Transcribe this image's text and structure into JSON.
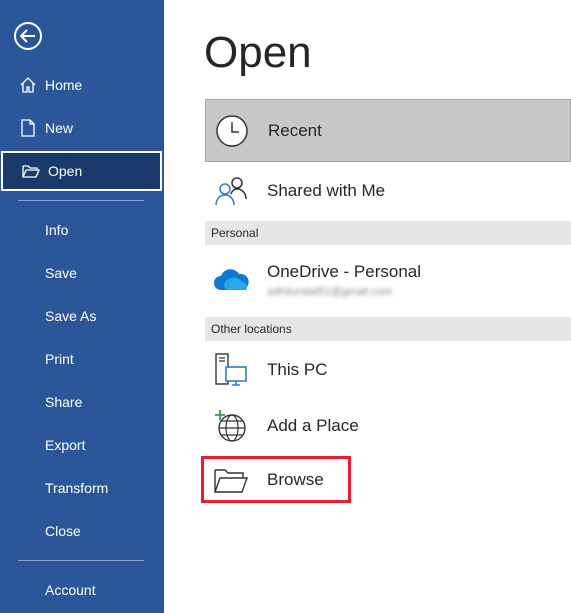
{
  "sidebar": {
    "items": [
      {
        "label": "Home",
        "icon": "home-icon"
      },
      {
        "label": "New",
        "icon": "new-document-icon"
      },
      {
        "label": "Open",
        "icon": "open-folder-icon"
      },
      {
        "label": "Info"
      },
      {
        "label": "Save"
      },
      {
        "label": "Save As"
      },
      {
        "label": "Print"
      },
      {
        "label": "Share"
      },
      {
        "label": "Export"
      },
      {
        "label": "Transform"
      },
      {
        "label": "Close"
      },
      {
        "label": "Account"
      }
    ],
    "active": "Open",
    "color": "#2b579a"
  },
  "main": {
    "title": "Open",
    "recent": "Recent",
    "shared": "Shared with Me",
    "section_personal": "Personal",
    "onedrive": {
      "name": "OneDrive - Personal",
      "email": "adhitundaf51@gmail.com"
    },
    "section_other": "Other locations",
    "this_pc": "This PC",
    "add_place": "Add a Place",
    "browse": "Browse",
    "highlight_color": "#e0202e"
  }
}
